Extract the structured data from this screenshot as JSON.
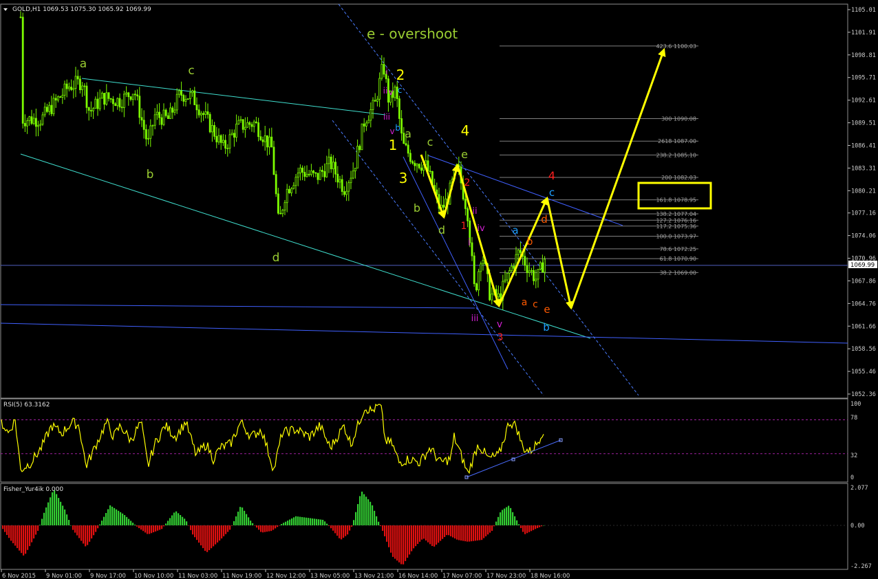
{
  "main_panel": {
    "title": "GOLD,H1  1069.53 1075.30 1065.92 1069.99",
    "current_price": "1069.99",
    "y_ticks": [
      "1105.01",
      "1101.91",
      "1098.81",
      "1095.71",
      "1092.61",
      "1089.51",
      "1086.41",
      "1083.31",
      "1080.21",
      "1077.16",
      "1074.06",
      "1070.96",
      "1067.86",
      "1064.76",
      "1061.66",
      "1058.56",
      "1055.46",
      "1052.36"
    ],
    "overshoot_label": "e - overshoot"
  },
  "fib_levels": [
    {
      "label": "423.6 1100.03",
      "price": 1100.03
    },
    {
      "label": "300 1090.08",
      "price": 1090.08
    },
    {
      "label": "2618 1087.00",
      "price": 1087.0
    },
    {
      "label": "238.2 1085.10",
      "price": 1085.1
    },
    {
      "label": "200 1082.03",
      "price": 1082.03
    },
    {
      "label": "161.8 1078.95",
      "price": 1078.95
    },
    {
      "label": "138.2 1077.04",
      "price": 1077.04
    },
    {
      "label": "127.2 1076.16",
      "price": 1076.16
    },
    {
      "label": "117.2 1075.36",
      "price": 1075.36
    },
    {
      "label": "100.0 1073.97",
      "price": 1073.97
    },
    {
      "label": "78.6 1072.25",
      "price": 1072.25
    },
    {
      "label": "61.8 1070.90",
      "price": 1070.9
    },
    {
      "label": "38.2 1069.00",
      "price": 1069.0
    }
  ],
  "wave_labels": [
    {
      "text": "a",
      "color": "#9acd32"
    },
    {
      "text": "c",
      "color": "#9acd32"
    },
    {
      "text": "b",
      "color": "#9acd32"
    },
    {
      "text": "d",
      "color": "#9acd32"
    },
    {
      "text": "i",
      "color": "#d020d0"
    },
    {
      "text": "2",
      "color": "#ffff00"
    },
    {
      "text": "ii",
      "color": "#d020d0"
    },
    {
      "text": "v",
      "color": "#d020d0"
    },
    {
      "text": "c",
      "color": "#1e9fff"
    },
    {
      "text": "iii",
      "color": "#d020d0"
    },
    {
      "text": "v",
      "color": "#d020d0"
    },
    {
      "text": "b",
      "color": "#1e9fff"
    },
    {
      "text": "a",
      "color": "#9acd32"
    },
    {
      "text": "1",
      "color": "#ffff00"
    },
    {
      "text": "c",
      "color": "#9acd32"
    },
    {
      "text": "4",
      "color": "#ffff00"
    },
    {
      "text": "e",
      "color": "#9acd32"
    },
    {
      "text": "3",
      "color": "#ffff00"
    },
    {
      "text": "2",
      "color": "#ff2020"
    },
    {
      "text": "b",
      "color": "#9acd32"
    },
    {
      "text": "d",
      "color": "#9acd32"
    },
    {
      "text": "1",
      "color": "#ff2020"
    },
    {
      "text": "ii",
      "color": "#d020d0"
    },
    {
      "text": "iv",
      "color": "#d020d0"
    },
    {
      "text": "i",
      "color": "#d020d0"
    },
    {
      "text": "iii",
      "color": "#d020d0"
    },
    {
      "text": "v",
      "color": "#d020d0"
    },
    {
      "text": "3",
      "color": "#ff2020"
    },
    {
      "text": "a",
      "color": "#1e9fff"
    },
    {
      "text": "b",
      "color": "#ff5a00"
    },
    {
      "text": "4",
      "color": "#ff2020"
    },
    {
      "text": "c",
      "color": "#1e9fff"
    },
    {
      "text": "d",
      "color": "#ff5a00"
    },
    {
      "text": "a",
      "color": "#ff5a00"
    },
    {
      "text": "c",
      "color": "#ff5a00"
    },
    {
      "text": "e",
      "color": "#ff5a00"
    },
    {
      "text": "b",
      "color": "#1e9fff"
    }
  ],
  "rsi_panel": {
    "title": "RSI(5) 63.3162",
    "y_ticks": [
      "100",
      "78",
      "32",
      "0"
    ]
  },
  "fisher_panel": {
    "title": "Fisher_Yur4ik 0.000",
    "y_ticks": [
      "2.077",
      "0.00",
      "-2.267"
    ]
  },
  "x_axis": {
    "labels": [
      "6 Nov 2015",
      "9 Nov 01:00",
      "9 Nov 17:00",
      "10 Nov 10:00",
      "11 Nov 03:00",
      "11 Nov 19:00",
      "12 Nov 12:00",
      "13 Nov 05:00",
      "13 Nov 21:00",
      "16 Nov 14:00",
      "17 Nov 07:00",
      "17 Nov 23:00",
      "18 Nov 16:00"
    ]
  },
  "colors": {
    "candle": "#7cfc00",
    "wave_arrow": "#ffff00",
    "channel_aqua": "#40e0d0",
    "channel_blue": "#4060ff",
    "fib": "#808080",
    "rsi_line": "#ffff00",
    "fisher_pos": "#32cd32",
    "fisher_neg": "#e01010"
  },
  "chart_data": [
    {
      "type": "candlestick",
      "symbol": "GOLD",
      "timeframe": "H1",
      "title": "GOLD,H1",
      "ohlc_last": {
        "open": 1069.53,
        "high": 1075.3,
        "low": 1065.92,
        "close": 1069.99
      },
      "ylim": [
        1052.36,
        1105.01
      ],
      "x_range": [
        "6 Nov 2015",
        "18 Nov 16:00"
      ],
      "key_points": [
        {
          "time": "6 Nov 2015",
          "price": 1105.0
        },
        {
          "time": "9 Nov 01:00",
          "price": 1089.0
        },
        {
          "time": "9 Nov 17:00",
          "price": 1095.5
        },
        {
          "time": "10 Nov 10:00",
          "price": 1086.5
        },
        {
          "time": "11 Nov 03:00",
          "price": 1093.5
        },
        {
          "time": "11 Nov 19:00",
          "price": 1085.0
        },
        {
          "time": "12 Nov 12:00",
          "price": 1074.5
        },
        {
          "time": "13 Nov 05:00",
          "price": 1084.0
        },
        {
          "time": "13 Nov 21:00",
          "price": 1097.0
        },
        {
          "time": "16 Nov 14:00",
          "price": 1083.0
        },
        {
          "time": "17 Nov 07:00",
          "price": 1064.5
        },
        {
          "time": "17 Nov 23:00",
          "price": 1071.5
        },
        {
          "time": "18 Nov 16:00",
          "price": 1069.99
        }
      ],
      "projection_path": [
        1083.2,
        1076.8,
        1083.5,
        1065.0,
        1078.9,
        1065.0,
        1098.8
      ]
    },
    {
      "type": "line",
      "title": "RSI(5) 63.3162",
      "ylim": [
        0,
        100
      ],
      "levels": [
        78,
        32
      ],
      "last_value": 63.3162
    },
    {
      "type": "bar",
      "title": "Fisher_Yur4ik 0.000",
      "ylim": [
        -2.267,
        2.077
      ],
      "last_value": 0.0
    }
  ]
}
